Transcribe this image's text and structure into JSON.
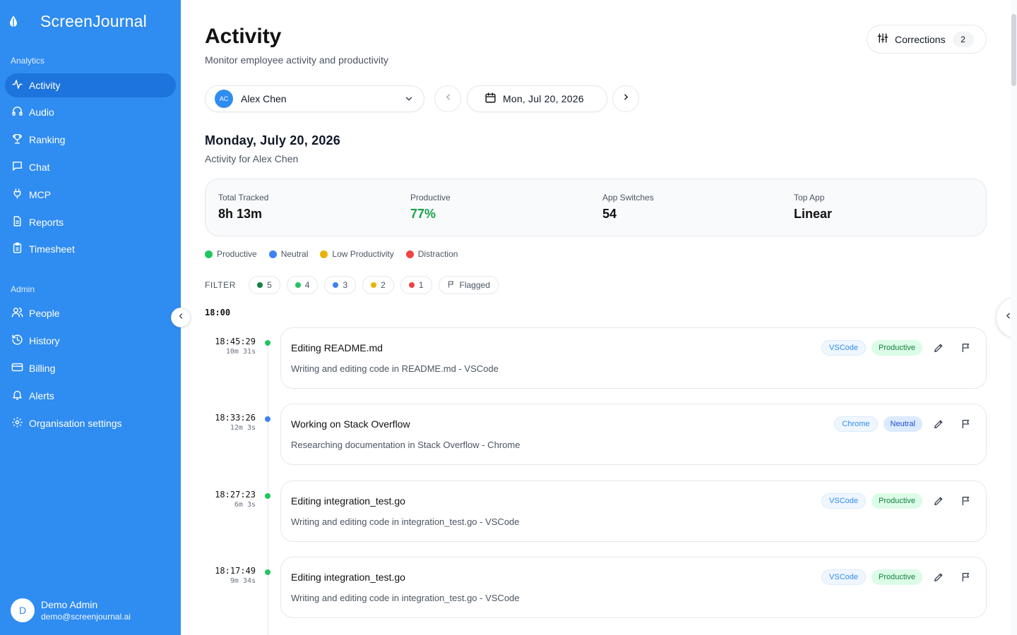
{
  "brand": {
    "name": "ScreenJournal",
    "icon": "ink-drop-icon"
  },
  "sidebar": {
    "analytics_label": "Analytics",
    "analytics_items": [
      {
        "label": "Activity",
        "icon": "activity-icon",
        "active": true
      },
      {
        "label": "Audio",
        "icon": "headphones-icon"
      },
      {
        "label": "Ranking",
        "icon": "trophy-icon"
      },
      {
        "label": "Chat",
        "icon": "chat-icon"
      },
      {
        "label": "MCP",
        "icon": "plug-icon"
      },
      {
        "label": "Reports",
        "icon": "report-icon"
      },
      {
        "label": "Timesheet",
        "icon": "clipboard-icon"
      }
    ],
    "admin_label": "Admin",
    "admin_items": [
      {
        "label": "People",
        "icon": "users-icon"
      },
      {
        "label": "History",
        "icon": "history-icon"
      },
      {
        "label": "Billing",
        "icon": "credit-card-icon"
      },
      {
        "label": "Alerts",
        "icon": "bell-icon"
      },
      {
        "label": "Organisation settings",
        "icon": "gear-icon"
      }
    ],
    "user": {
      "initial": "D",
      "name": "Demo Admin",
      "email": "demo@screenjournal.ai"
    }
  },
  "header": {
    "title": "Activity",
    "subtitle": "Monitor employee activity and productivity",
    "corrections_label": "Corrections",
    "corrections_count": "2"
  },
  "controls": {
    "user_initials": "AC",
    "user_name": "Alex Chen",
    "date": "Mon, Jul 20, 2026"
  },
  "day": {
    "heading": "Monday, July 20, 2026",
    "subheading": "Activity for Alex Chen"
  },
  "stats": [
    {
      "label": "Total Tracked",
      "value": "8h 13m"
    },
    {
      "label": "Productive",
      "value": "77%"
    },
    {
      "label": "App Switches",
      "value": "54"
    },
    {
      "label": "Top App",
      "value": "Linear"
    }
  ],
  "legend": [
    {
      "label": "Productive",
      "color": "#22c55e"
    },
    {
      "label": "Neutral",
      "color": "#3b82f6"
    },
    {
      "label": "Low Productivity",
      "color": "#eab308"
    },
    {
      "label": "Distraction",
      "color": "#ef4444"
    }
  ],
  "filter": {
    "label": "FILTER",
    "chips": [
      {
        "value": "5",
        "color": "#15803d"
      },
      {
        "value": "4",
        "color": "#22c55e"
      },
      {
        "value": "3",
        "color": "#3b82f6"
      },
      {
        "value": "2",
        "color": "#eab308"
      },
      {
        "value": "1",
        "color": "#ef4444"
      }
    ],
    "flagged_label": "Flagged"
  },
  "timeline": {
    "hour_label": "18:00",
    "entries": [
      {
        "time": "18:45:29",
        "duration": "10m 31s",
        "dot_color": "#22c55e",
        "title": "Editing README.md",
        "description": "Writing and editing code in README.md - VSCode",
        "app": "VSCode",
        "category": "Productive",
        "category_type": "prod"
      },
      {
        "time": "18:33:26",
        "duration": "12m 3s",
        "dot_color": "#3b82f6",
        "title": "Working on Stack Overflow",
        "description": "Researching documentation in Stack Overflow - Chrome",
        "app": "Chrome",
        "category": "Neutral",
        "category_type": "neut"
      },
      {
        "time": "18:27:23",
        "duration": "6m 3s",
        "dot_color": "#22c55e",
        "title": "Editing integration_test.go",
        "description": "Writing and editing code in integration_test.go - VSCode",
        "app": "VSCode",
        "category": "Productive",
        "category_type": "prod"
      },
      {
        "time": "18:17:49",
        "duration": "9m 34s",
        "dot_color": "#22c55e",
        "title": "Editing integration_test.go",
        "description": "Writing and editing code in integration_test.go - VSCode",
        "app": "VSCode",
        "category": "Productive",
        "category_type": "prod"
      }
    ]
  }
}
